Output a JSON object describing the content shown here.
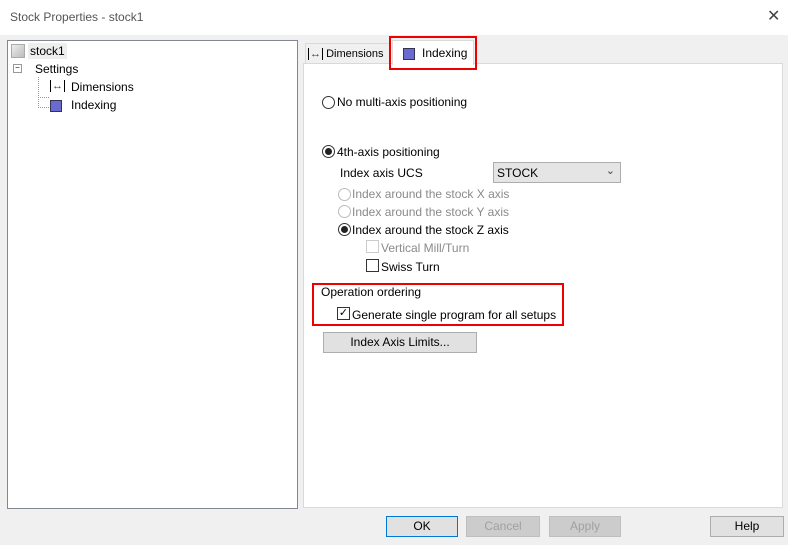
{
  "window": {
    "title": "Stock Properties - stock1",
    "close_icon": "close-icon"
  },
  "tree": {
    "root": "stock1",
    "settings": "Settings",
    "items": [
      {
        "label": "Dimensions",
        "icon": "dimensions-icon"
      },
      {
        "label": "Indexing",
        "icon": "indexing-icon"
      }
    ]
  },
  "tabs": [
    {
      "label": "Dimensions"
    },
    {
      "label": "Indexing",
      "selected": true
    }
  ],
  "indexing": {
    "no_multi_axis": "No multi-axis positioning",
    "fourth_axis": "4th-axis positioning",
    "ucs_label": "Index axis UCS",
    "ucs_value": "STOCK",
    "x_axis": "Index around the stock X axis",
    "y_axis": "Index around the stock Y axis",
    "z_axis": "Index around the stock Z axis",
    "vertical_mill_turn": "Vertical Mill/Turn",
    "swiss_turn": "Swiss Turn",
    "operation_ordering": "Operation ordering",
    "single_program": "Generate single program for all setups",
    "limits_button": "Index Axis Limits..."
  },
  "buttons": {
    "ok": "OK",
    "cancel": "Cancel",
    "apply": "Apply",
    "help": "Help"
  },
  "highlight_color": "#e00000"
}
